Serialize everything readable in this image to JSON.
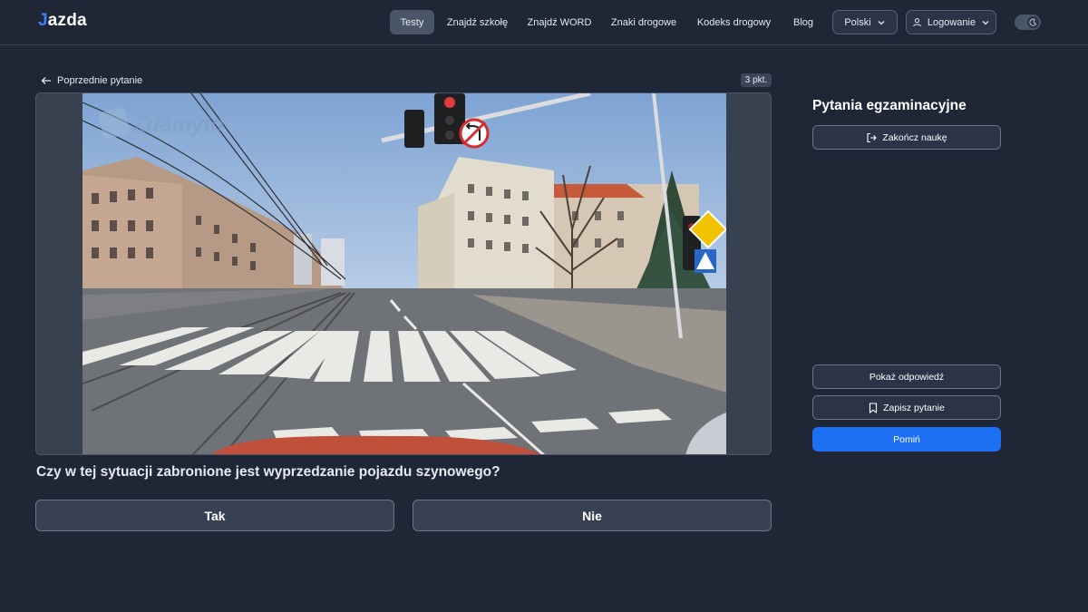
{
  "header": {
    "logo_letter": "J",
    "logo_rest": "azda",
    "nav": [
      {
        "label": "Testy",
        "active": true
      },
      {
        "label": "Znajdź szkołę"
      },
      {
        "label": "Znajdź WORD"
      },
      {
        "label": "Znaki drogowe"
      },
      {
        "label": "Kodeks drogowy"
      },
      {
        "label": "Blog"
      }
    ],
    "language_label": "Polski",
    "login_label": "Logowanie",
    "theme_toggle": "dark-mode-moon-icon"
  },
  "question_area": {
    "back_label": "Poprzednie pytanie",
    "points_label": "3 pkt.",
    "watermark": "Zdamyto",
    "question_text": "Czy w tej sytuacji zabronione jest wyprzedzanie pojazdu szynowego?",
    "answers": [
      "Tak",
      "Nie"
    ]
  },
  "side_panel": {
    "title": "Pytania egzaminacyjne",
    "end_label": "Zakończ naukę",
    "show_answer_label": "Pokaż odpowiedź",
    "save_label": "Zapisz pytanie",
    "skip_label": "Pomiń"
  },
  "colors": {
    "background": "#1f2737",
    "primary": "#1d6ff2",
    "accent_logo": "#3b82f6"
  }
}
